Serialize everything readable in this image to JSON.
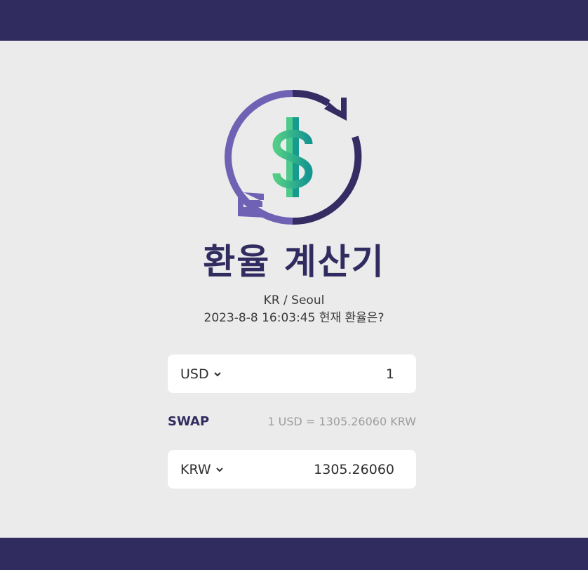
{
  "title": "환율 계산기",
  "location": "KR / Seoul",
  "datetime_text": "2023-8-8 16:03:45 현재 환율은?",
  "from": {
    "currency": "USD",
    "amount": "1"
  },
  "to": {
    "currency": "KRW",
    "amount": "1305.26060"
  },
  "swap_label": "SWAP",
  "rate_text": "1 USD = 1305.26060 KRW",
  "colors": {
    "header": "#312c60",
    "background": "#ebebeb",
    "accent_purple": "#6f62b4",
    "dark_purple": "#342c63",
    "dollar_green": "#4ccb8d",
    "dollar_teal": "#179b8f"
  },
  "icons": {
    "logo": "currency-exchange-icon",
    "dropdown": "chevron-down-icon"
  }
}
